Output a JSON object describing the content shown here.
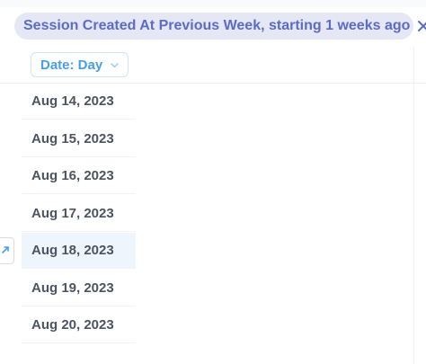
{
  "filter": {
    "label": "Session Created At Previous Week, starting 1 weeks ago"
  },
  "column": {
    "date_button_label": "Date: Day"
  },
  "rows": [
    {
      "label": "Aug 14, 2023"
    },
    {
      "label": "Aug 15, 2023"
    },
    {
      "label": "Aug 16, 2023"
    },
    {
      "label": "Aug 17, 2023"
    },
    {
      "label": "Aug 18, 2023"
    },
    {
      "label": "Aug 19, 2023"
    },
    {
      "label": "Aug 20, 2023"
    }
  ],
  "colors": {
    "filter_text": "#5b6cc7",
    "filter_bg": "#e5e7f5",
    "accent": "#4a9ee8",
    "row_text": "#4c5461",
    "active_row_bg": "#eef5fc"
  },
  "icons": {
    "filter_close": "close-icon",
    "dropdown": "chevron-down-icon",
    "expand": "expand-arrow-icon"
  }
}
